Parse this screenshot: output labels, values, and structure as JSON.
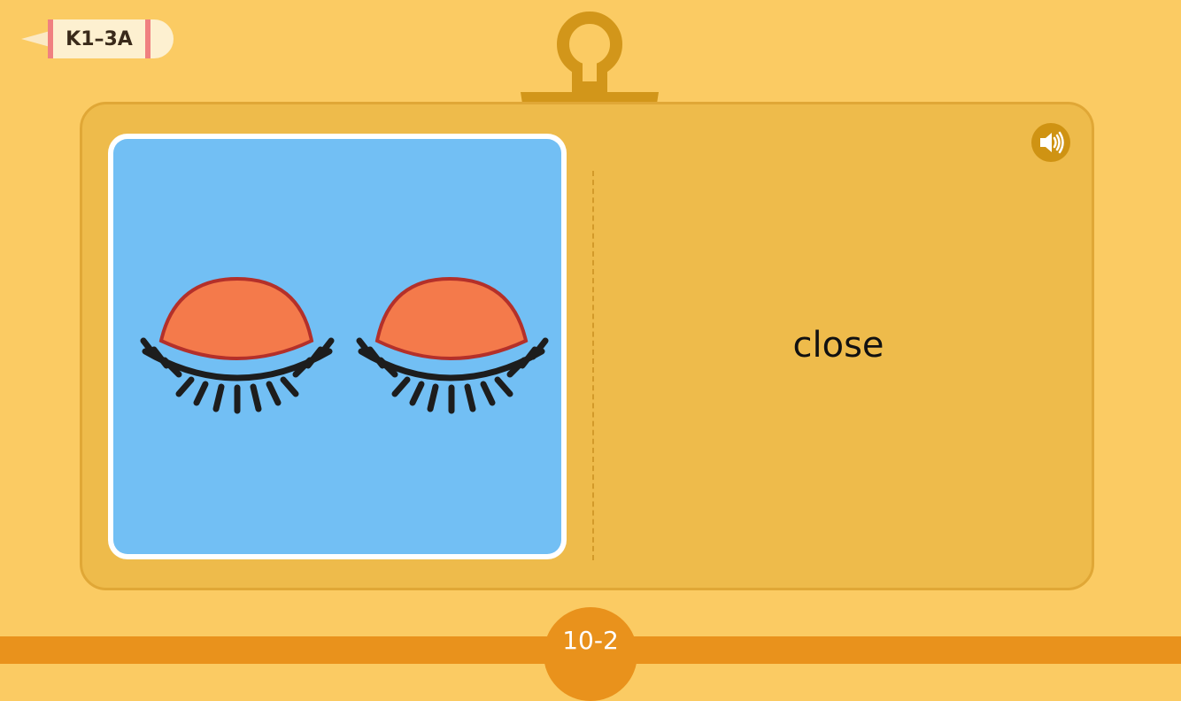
{
  "level_tag": {
    "label": "K1–3A"
  },
  "flashcard": {
    "image": "closed-eyes-illustration",
    "word": "close",
    "sound_icon": "speaker-icon"
  },
  "footer": {
    "page_label": "10-2"
  },
  "colors": {
    "background": "#fbcb63",
    "card": "#eebb4b",
    "picture_bg": "#72bff4",
    "eyelid": "#f47a4b",
    "footer": "#e9921c",
    "clip": "#d2961a"
  }
}
